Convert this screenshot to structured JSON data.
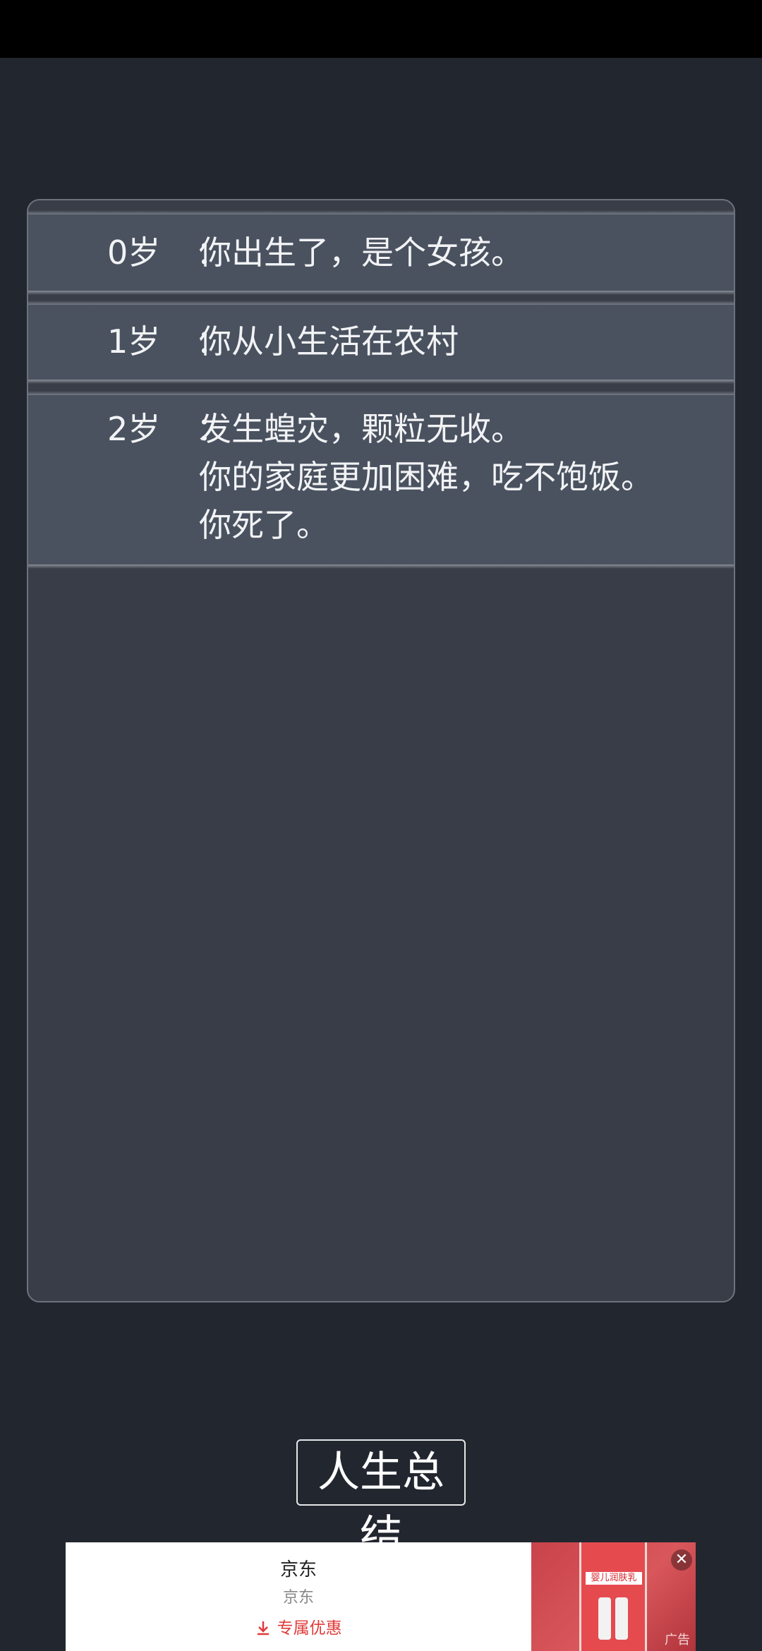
{
  "log": {
    "entries": [
      {
        "age": "0岁",
        "separator": "：",
        "lines": [
          "你出生了，是个女孩。"
        ]
      },
      {
        "age": "1岁",
        "separator": "：",
        "lines": [
          "你从小生活在农村"
        ]
      },
      {
        "age": "2岁",
        "separator": "：",
        "lines": [
          "发生蝗灾，颗粒无收。",
          "你的家庭更加困难，吃不饱饭。",
          "你死了。"
        ]
      }
    ]
  },
  "actions": {
    "summary_label": "人生总结"
  },
  "ad": {
    "title": "京东",
    "subtitle": "京东",
    "cta_label": "专属优惠",
    "product_text": "婴儿润肤乳",
    "ad_label": "广告",
    "close_icon": "close-icon",
    "download_icon": "download-icon"
  },
  "colors": {
    "background": "#22262f",
    "panel": "#393d47",
    "entry": "#4a5260",
    "text": "#f2f3f5",
    "ad_accent": "#e03a3a"
  }
}
